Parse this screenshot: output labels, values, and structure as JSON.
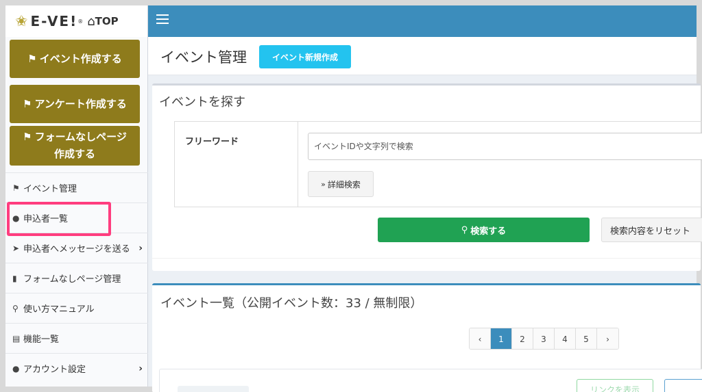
{
  "logo": {
    "brand": "E-VE!",
    "reg": "®",
    "top": "TOP"
  },
  "sidebar": {
    "buttons": [
      {
        "label": "イベント作成する"
      },
      {
        "label": "アンケート作成する"
      },
      {
        "label_line1": "フォームなしページ",
        "label_line2": "作成する"
      }
    ],
    "items": [
      {
        "label": "イベント管理",
        "icon": "flag-icon"
      },
      {
        "label": "申込者一覧",
        "icon": "user-icon"
      },
      {
        "label": "申込者へメッセージを送る",
        "icon": "paper-plane-icon"
      },
      {
        "label": "フォームなしページ管理",
        "icon": "file-icon"
      },
      {
        "label": "使い方マニュアル",
        "icon": "search-icon"
      },
      {
        "label": "機能一覧",
        "icon": "book-icon"
      },
      {
        "label": "アカウント設定",
        "icon": "user-gear-icon"
      }
    ]
  },
  "header": {
    "title": "イベント管理",
    "new_button": "イベント新規作成"
  },
  "search": {
    "title": "イベントを探す",
    "keyword_label": "フリーワード",
    "keyword_placeholder": "イベントIDや文字列で検索",
    "advanced_button": "詳細検索",
    "search_button": "検索する",
    "reset_button": "検索内容をリセット"
  },
  "list": {
    "title": "イベント一覧（公開イベント数：33 / 無制限）",
    "pager": [
      "‹",
      "1",
      "2",
      "3",
      "4",
      "5",
      "›"
    ],
    "active_page": "1",
    "card_button": "リンクを表示"
  },
  "colors": {
    "topbar": "#3c8dbc",
    "gold": "#8e7b1c",
    "highlight": "#ff3d7f",
    "search_green": "#20a253",
    "new_button": "#23c3ef"
  }
}
